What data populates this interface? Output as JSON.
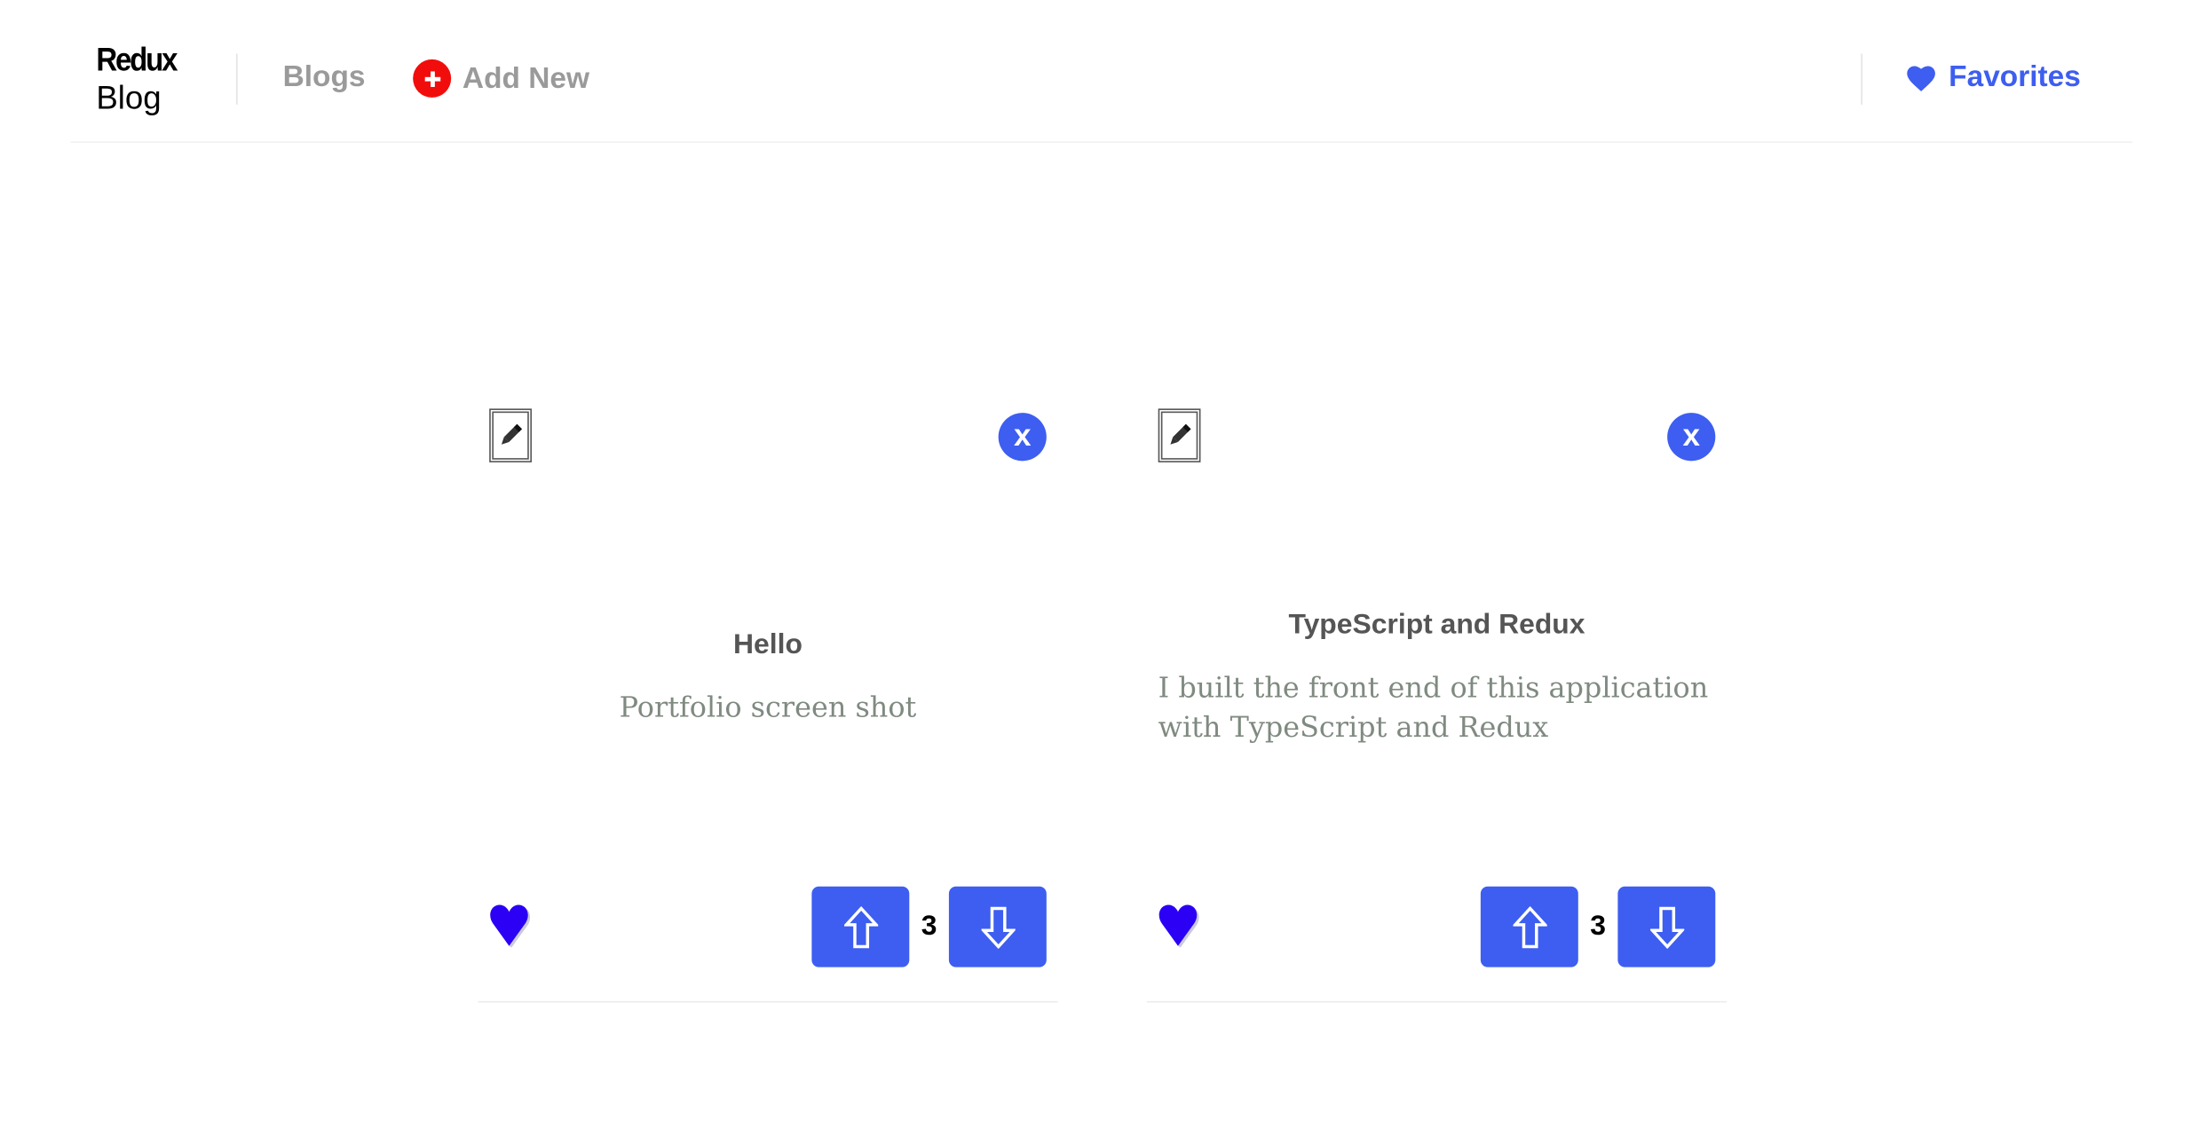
{
  "header": {
    "logo_line1": "Redux",
    "logo_line2": "Blog",
    "nav_blogs": "Blogs",
    "nav_add_new": "Add New",
    "nav_favorites": "Favorites"
  },
  "icons": {
    "add": "plus-circle-icon",
    "favorites": "heart-icon",
    "edit": "pencil-icon",
    "close": "close-icon",
    "favorite_toggle": "heart-icon",
    "upvote": "arrow-up-icon",
    "downvote": "arrow-down-icon"
  },
  "colors": {
    "accent": "#3d5ef0",
    "add_icon": "#f20d0d",
    "heart": "#2b00f5",
    "nav_text": "#9a9a9a"
  },
  "posts": [
    {
      "title": "Hello",
      "body": "Portfolio screen shot",
      "votes": "3",
      "close_label": "x"
    },
    {
      "title": "TypeScript and Redux",
      "body": "I built the front end of this application with TypeScript and Redux",
      "votes": "3",
      "close_label": "x"
    }
  ]
}
